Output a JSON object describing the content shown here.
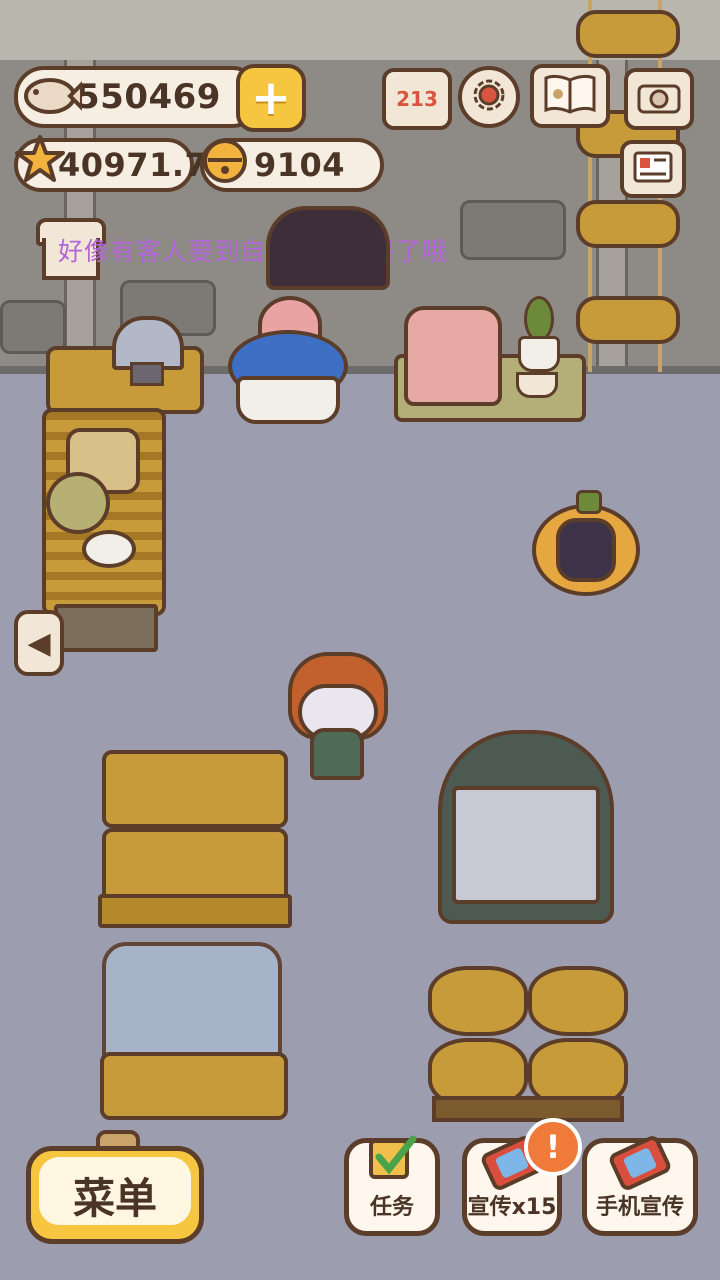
{
  "currency": {
    "fish": "550469",
    "stars": "40971.7",
    "bells": "9104"
  },
  "top_icons": [
    "ranking-icon",
    "settings-gear-icon",
    "guide-book-icon",
    "camera-icon",
    "news-card-icon"
  ],
  "notice": "好像有客人要到自助餐厅聚餐了哦",
  "bottom": {
    "menu_label": "菜单",
    "task_label": "任务",
    "promo_label": "宣传x15",
    "promo_badge": "!",
    "phone_promo_label": "手机宣传"
  },
  "ranking_text": "213",
  "colors": {
    "accent": "#f7c640",
    "outline": "#5b3d2a",
    "notice": "#b266d8",
    "badge": "#f07a3a"
  }
}
